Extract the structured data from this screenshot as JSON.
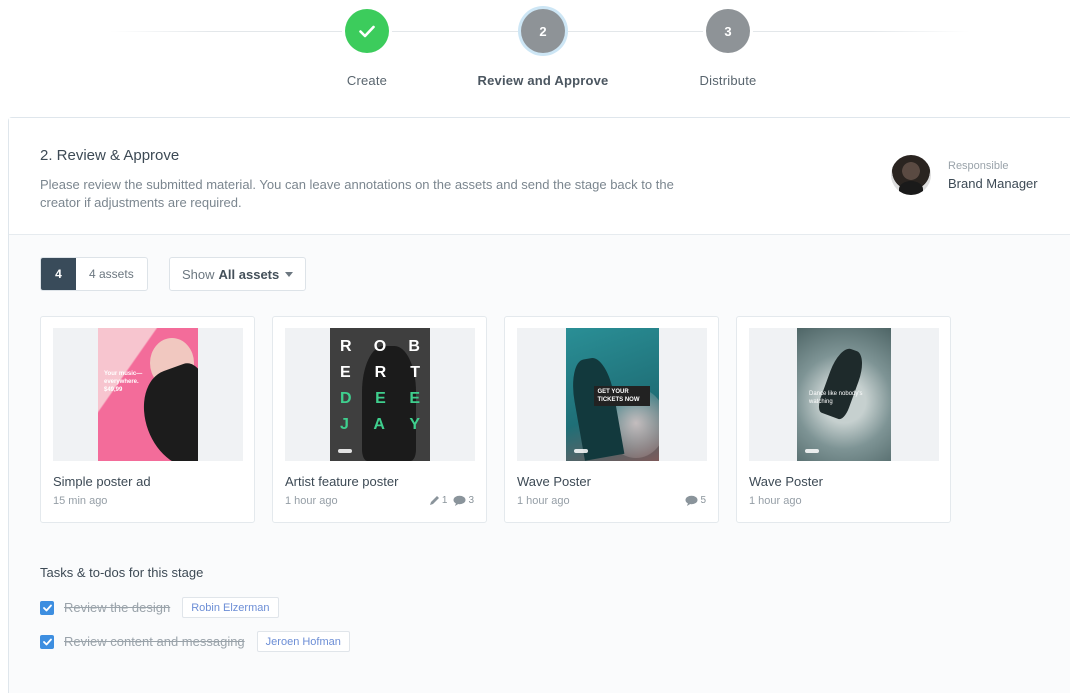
{
  "stepper": {
    "steps": [
      {
        "label": "Create",
        "state": "done",
        "number": ""
      },
      {
        "label": "Review and Approve",
        "state": "current",
        "number": "2"
      },
      {
        "label": "Distribute",
        "state": "todo",
        "number": "3"
      }
    ],
    "colors": {
      "done": "#3ccc5c",
      "pending": "#8e9397"
    }
  },
  "stage": {
    "title": "2. Review & Approve",
    "description": "Please review the submitted material. You can leave annotations on the assets and send the stage back to the creator if adjustments are required.",
    "responsible_label": "Responsible",
    "responsible_name": "Brand Manager"
  },
  "toolbar": {
    "count": "4",
    "count_label": "4 assets",
    "filter_prefix": "Show",
    "filter_value": "All assets"
  },
  "assets": [
    {
      "title": "Simple poster ad",
      "time": "15 min ago",
      "edits": "",
      "comments": "",
      "poster_text": "Your music— everywhere. $49,99"
    },
    {
      "title": "Artist feature poster",
      "time": "1 hour ago",
      "edits": "1",
      "comments": "3",
      "poster_text": "R O B E R T D E E J A Y"
    },
    {
      "title": "Wave Poster",
      "time": "1 hour ago",
      "edits": "",
      "comments": "5",
      "poster_text": "GET YOUR TICKETS NOW"
    },
    {
      "title": "Wave Poster",
      "time": "1 hour ago",
      "edits": "",
      "comments": "",
      "poster_text": "Dance like nobody's watching"
    }
  ],
  "tasks": {
    "title": "Tasks & to-dos for this stage",
    "items": [
      {
        "label": "Review the design",
        "assignee": "Robin Elzerman",
        "done": true
      },
      {
        "label": "Review content and messaging",
        "assignee": "Jeroen Hofman",
        "done": true
      }
    ]
  },
  "accent_color": "#3d8ee0"
}
